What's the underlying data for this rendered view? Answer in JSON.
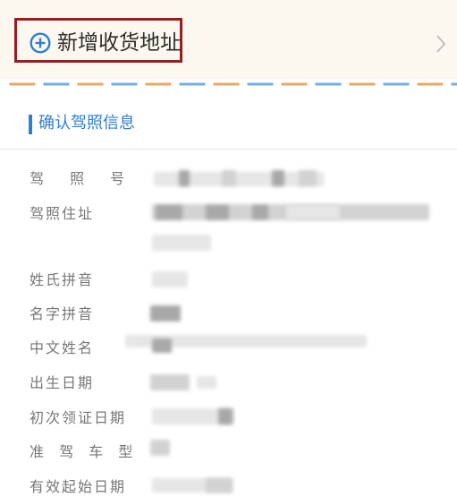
{
  "address": {
    "add_label": "新增收货地址"
  },
  "section": {
    "title": "确认驾照信息"
  },
  "license_fields": [
    {
      "label": "驾 照 号"
    },
    {
      "label": "驾照住址"
    },
    {
      "label": "姓氏拼音"
    },
    {
      "label": "名字拼音"
    },
    {
      "label": "中文姓名"
    },
    {
      "label": "出生日期"
    },
    {
      "label": "初次领证日期"
    },
    {
      "label": "准 驾 车 型"
    },
    {
      "label": "有效起始日期"
    }
  ],
  "icons": {
    "add": "plus-circle-icon",
    "navigate": "chevron-right-icon"
  },
  "colors": {
    "accent_blue": "#2f7fd0",
    "highlight_red": "#9b1c22",
    "stripe_orange": "#e8a865",
    "stripe_blue": "#73aee0",
    "address_bg": "#fdf8ef"
  }
}
